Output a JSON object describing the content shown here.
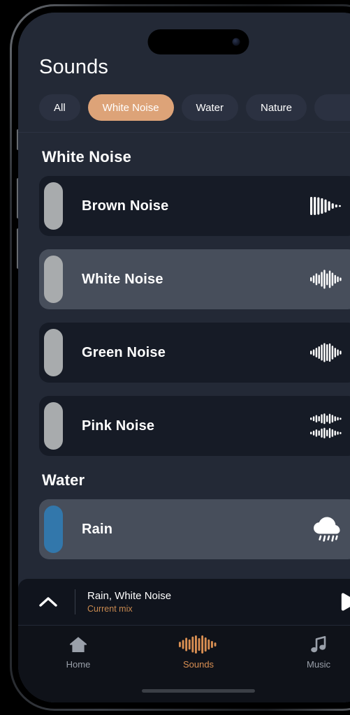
{
  "header": {
    "title": "Sounds"
  },
  "filters": {
    "chips": [
      {
        "label": "All",
        "active": false
      },
      {
        "label": "White Noise",
        "active": true
      },
      {
        "label": "Water",
        "active": false
      },
      {
        "label": "Nature",
        "active": false
      }
    ],
    "active_color": "#dda378"
  },
  "sections": [
    {
      "title": "White Noise",
      "items": [
        {
          "name": "Brown Noise",
          "icon": "waveform-descending-icon",
          "selected": false,
          "accent": "#a8abad"
        },
        {
          "name": "White Noise",
          "icon": "waveform-center-peak-icon",
          "selected": true,
          "accent": "#a8abad"
        },
        {
          "name": "Green Noise",
          "icon": "waveform-wave-icon",
          "selected": false,
          "accent": "#a8abad"
        },
        {
          "name": "Pink Noise",
          "icon": "waveform-mirrored-icon",
          "selected": false,
          "accent": "#a8abad"
        }
      ]
    },
    {
      "title": "Water",
      "items": [
        {
          "name": "Rain",
          "icon": "rain-cloud-icon",
          "selected": true,
          "accent": "#3277ab"
        }
      ]
    }
  ],
  "mini_player": {
    "track": "Rain, White Noise",
    "subtitle": "Current mix",
    "subtitle_color": "#c8894f",
    "expand_icon": "chevron-up-icon",
    "play_icon": "play-icon"
  },
  "tab_bar": {
    "tabs": [
      {
        "label": "Home",
        "icon": "home-icon",
        "active": false
      },
      {
        "label": "Sounds",
        "icon": "waveform-icon",
        "active": true
      },
      {
        "label": "Music",
        "icon": "music-note-icon",
        "active": false
      }
    ],
    "active_color": "#d98f52"
  }
}
